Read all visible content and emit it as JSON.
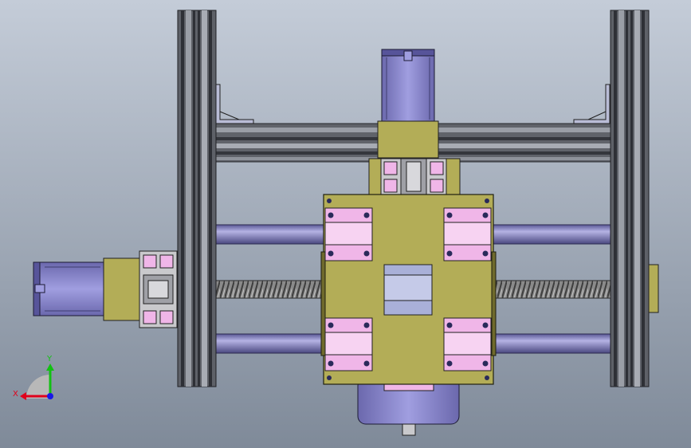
{
  "view": {
    "background_top": "#c4ccd8",
    "background_bottom": "#7f8a99"
  },
  "colors": {
    "frame_rail": "#5e6168",
    "frame_rail_light": "#9a9ea6",
    "frame_rail_dark": "#2e3036",
    "olive_plate": "#b3ad57",
    "olive_dark": "#6f6a2c",
    "bearing_block": "#f0b6e8",
    "guide_rod": "#7a77b6",
    "guide_rod_highlight": "#b5b3e4",
    "lead_screw": "#7d7d7d",
    "motor_body": "#8481c6",
    "motor_dark": "#3f3d6e",
    "nut_block": "#a9b0d8",
    "aluminum_profile": "#c9c9cc",
    "bracket": "#b9bcd6",
    "axis_x": "#e0001b",
    "axis_y": "#12c112",
    "axis_z": "#1818e6"
  },
  "triad": {
    "x_label": "X",
    "y_label": "Y"
  }
}
